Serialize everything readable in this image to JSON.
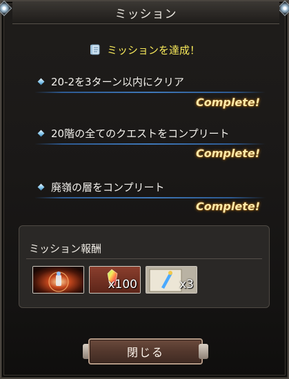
{
  "dialog": {
    "title": "ミッション"
  },
  "header": {
    "text": "ミッションを達成！",
    "icon": "scroll-icon"
  },
  "missions": [
    {
      "text": "20-2を3ターン以内にクリア",
      "status": "Complete!"
    },
    {
      "text": "20階の全てのクエストをコンプリート",
      "status": "Complete!"
    },
    {
      "text": "廃嶺の層をコンプリート",
      "status": "Complete!"
    }
  ],
  "rewards": {
    "label": "ミッション報酬",
    "items": [
      {
        "name": "summon-ticket",
        "count": ""
      },
      {
        "name": "crystal",
        "count": "x100"
      },
      {
        "name": "ticket",
        "count": "x3"
      }
    ]
  },
  "footer": {
    "close_label": "閉じる"
  },
  "colors": {
    "accent": "#f6e85a",
    "complete": "#ffe9a8",
    "underline": "#3f78b8"
  }
}
